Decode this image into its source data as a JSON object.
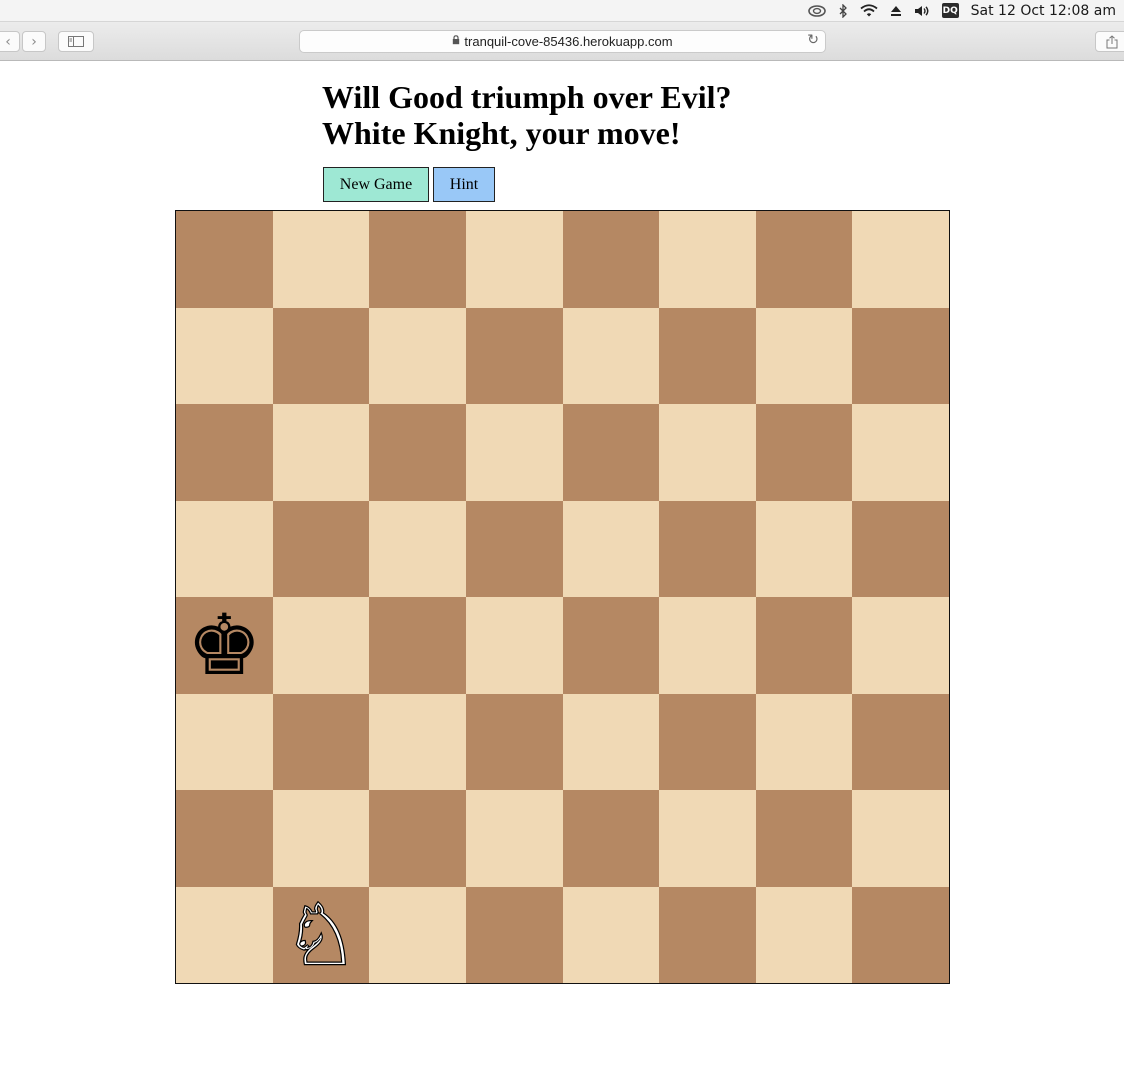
{
  "menubar": {
    "icons": [
      "creative-cloud-icon",
      "bluetooth-icon",
      "wifi-icon",
      "eject-icon",
      "volume-icon"
    ],
    "dq_badge": "DQ",
    "clock": "Sat 12 Oct  12:08 am"
  },
  "browser": {
    "url": "tranquil-cove-85436.herokuapp.com"
  },
  "page": {
    "title_line1": "Will Good triumph over Evil?",
    "title_line2": "White Knight, your move!",
    "new_game_label": "New Game",
    "hint_label": "Hint"
  },
  "board": {
    "light_color": "#f0d9b5",
    "dark_color": "#b58863",
    "files": [
      "a",
      "b",
      "c",
      "d",
      "e",
      "f",
      "g",
      "h"
    ],
    "ranks": [
      8,
      7,
      6,
      5,
      4,
      3,
      2,
      1
    ],
    "first_square_dark": true,
    "pieces": [
      {
        "square": "a4",
        "piece": "king",
        "color": "black",
        "glyph": "♚"
      },
      {
        "square": "b1",
        "piece": "knight",
        "color": "white",
        "glyph": "♘"
      }
    ]
  }
}
